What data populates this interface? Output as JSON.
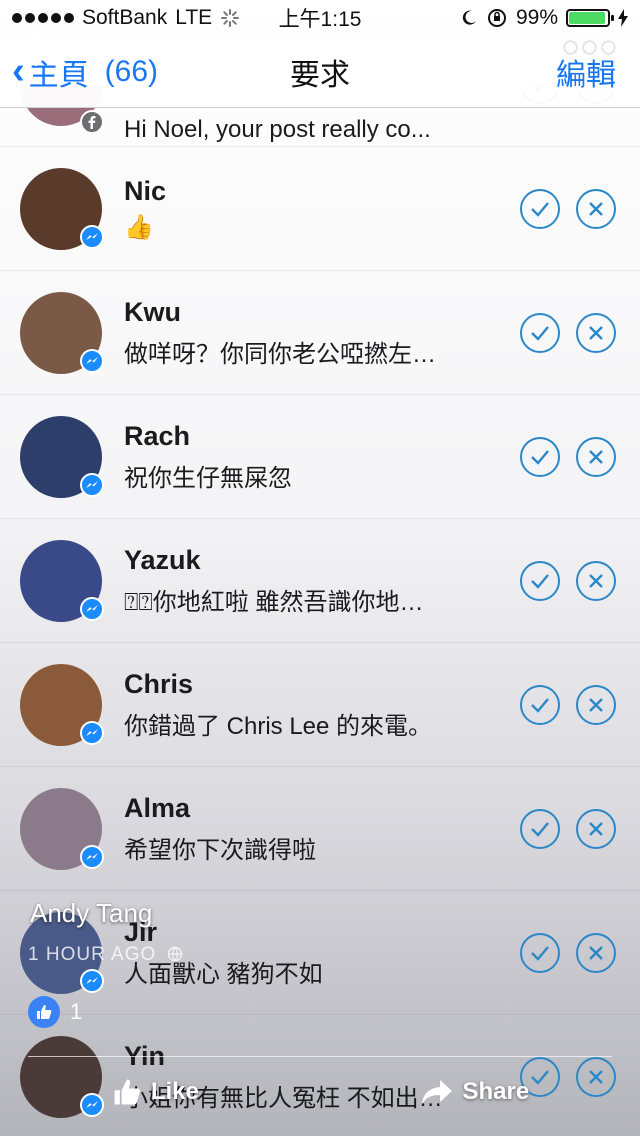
{
  "status_bar": {
    "carrier": "SoftBank",
    "network": "LTE",
    "time": "上午1:15",
    "battery_percent": "99%"
  },
  "nav": {
    "back_label": "主頁",
    "count": "(66)",
    "title": "要求",
    "edit_label": "編輯"
  },
  "requests": [
    {
      "name": "",
      "message": "Hi Noel, your post really co...",
      "badge": "facebook-icon",
      "avatar_color": "#9a6d7a"
    },
    {
      "name": "Nic",
      "message": "👍",
      "badge": "messenger-icon",
      "avatar_color": "#5a3a2a"
    },
    {
      "name": "Kwu",
      "message": "做咩呀？你同你老公啞撚左…",
      "badge": "messenger-icon",
      "avatar_color": "#7a5a46"
    },
    {
      "name": "Rach",
      "message": "祝你生仔無屎忽",
      "badge": "messenger-icon",
      "avatar_color": "#2e3e6a"
    },
    {
      "name": "Yazuk",
      "message": "⍰⍰你地紅啦 雖然吾識你地…",
      "badge": "messenger-icon",
      "avatar_color": "#3a4a88"
    },
    {
      "name": "Chris",
      "message": "你錯過了 Chris Lee 的來電。",
      "badge": "messenger-icon",
      "avatar_color": "#8a5a3a"
    },
    {
      "name": "Alma",
      "message": "希望你下次識得啦",
      "badge": "messenger-icon",
      "avatar_color": "#8a7a8a"
    },
    {
      "name": "Jir",
      "message": "人面獸心 豬狗不如",
      "badge": "messenger-icon",
      "avatar_color": "#4a5a88"
    },
    {
      "name": "Yin",
      "message": "小姐你有無比人冤枉 不如出…",
      "badge": "messenger-icon",
      "avatar_color": "#4a3a38"
    }
  ],
  "post_overlay": {
    "poster_name": "Andy Tang",
    "time_label": "1 HOUR AGO",
    "like_count": "1",
    "like_label": "Like",
    "share_label": "Share"
  },
  "colors": {
    "accent": "#1877f2",
    "action_ring": "#2a88c8"
  }
}
